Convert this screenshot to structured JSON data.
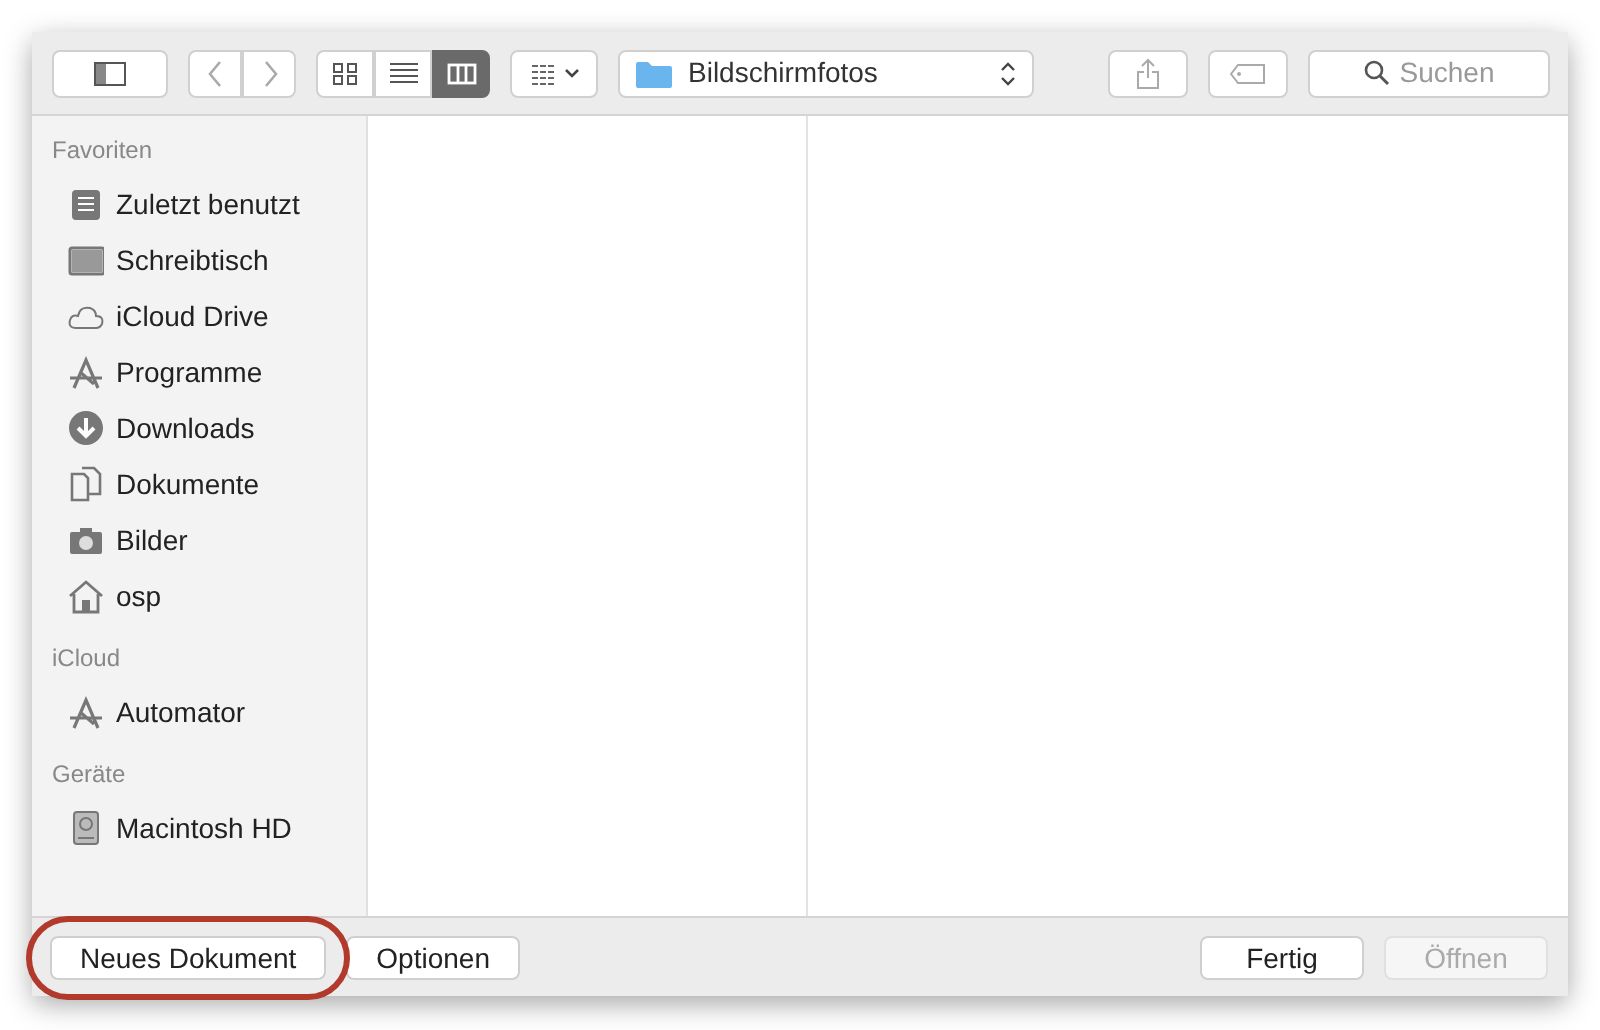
{
  "toolbar": {
    "views": [
      {
        "kind": "icons",
        "selected": false
      },
      {
        "kind": "list",
        "selected": false
      },
      {
        "kind": "columns",
        "selected": true
      }
    ],
    "location": "Bildschirmfotos",
    "search": {
      "placeholder": "Suchen"
    }
  },
  "sidebar": {
    "sections": [
      {
        "title": "Favoriten",
        "items": [
          {
            "label": "Zuletzt benutzt",
            "kind": "recent"
          },
          {
            "label": "Schreibtisch",
            "kind": "desktop"
          },
          {
            "label": "iCloud Drive",
            "kind": "cloud"
          },
          {
            "label": "Programme",
            "kind": "apps"
          },
          {
            "label": "Downloads",
            "kind": "downloads"
          },
          {
            "label": "Dokumente",
            "kind": "documents"
          },
          {
            "label": "Bilder",
            "kind": "pictures"
          },
          {
            "label": "osp",
            "kind": "home"
          }
        ]
      },
      {
        "title": "iCloud",
        "items": [
          {
            "label": "Automator",
            "kind": "apps"
          }
        ]
      },
      {
        "title": "Geräte",
        "items": [
          {
            "label": "Macintosh HD",
            "kind": "disk"
          }
        ]
      }
    ]
  },
  "footer": {
    "left": [
      {
        "label": "Neues Dokument",
        "disabled": false,
        "annotated": true
      },
      {
        "label": "Optionen",
        "disabled": false,
        "annotated": false
      }
    ],
    "right": [
      {
        "label": "Fertig",
        "disabled": false,
        "annotated": false
      },
      {
        "label": "Öffnen",
        "disabled": true,
        "annotated": false
      }
    ]
  }
}
